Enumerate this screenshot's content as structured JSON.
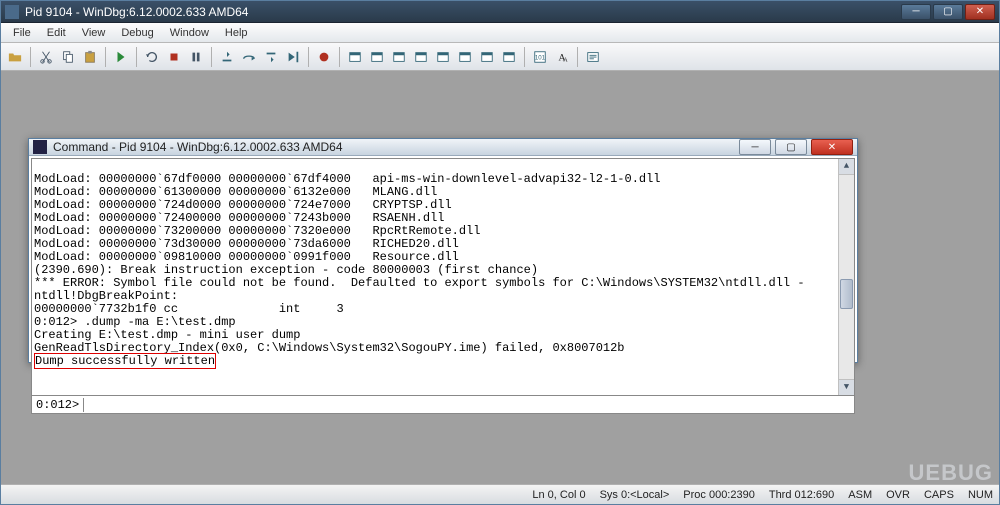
{
  "mainWindow": {
    "title": "Pid 9104 - WinDbg:6.12.0002.633 AMD64"
  },
  "menu": {
    "items": [
      "File",
      "Edit",
      "View",
      "Debug",
      "Window",
      "Help"
    ]
  },
  "childWindow": {
    "title": "Command - Pid 9104 - WinDbg:6.12.0002.633 AMD64",
    "prompt": "0:012>",
    "inputValue": "",
    "output": [
      "ModLoad: 00000000`67df0000 00000000`67df4000   api-ms-win-downlevel-advapi32-l2-1-0.dll",
      "ModLoad: 00000000`61300000 00000000`6132e000   MLANG.dll",
      "ModLoad: 00000000`724d0000 00000000`724e7000   CRYPTSP.dll",
      "ModLoad: 00000000`72400000 00000000`7243b000   RSAENH.dll",
      "ModLoad: 00000000`73200000 00000000`7320e000   RpcRtRemote.dll",
      "ModLoad: 00000000`73d30000 00000000`73da6000   RICHED20.dll",
      "ModLoad: 00000000`09810000 00000000`0991f000   Resource.dll",
      "(2390.690): Break instruction exception - code 80000003 (first chance)",
      "*** ERROR: Symbol file could not be found.  Defaulted to export symbols for C:\\Windows\\SYSTEM32\\ntdll.dll - ",
      "ntdll!DbgBreakPoint:",
      "00000000`7732b1f0 cc              int     3",
      "0:012> .dump -ma E:\\test.dmp",
      "Creating E:\\test.dmp - mini user dump",
      "GenReadTlsDirectory_Index(0x0, C:\\Windows\\System32\\SogouPY.ime) failed, 0x8007012b"
    ],
    "highlightedLine": "Dump successfully written"
  },
  "status": {
    "lncol": "Ln 0, Col 0",
    "sys": "Sys 0:<Local>",
    "proc": "Proc 000:2390",
    "thrd": "Thrd 012:690",
    "asm": "ASM",
    "ovr": "OVR",
    "caps": "CAPS",
    "num": "NUM"
  },
  "watermark": "UEBUG"
}
